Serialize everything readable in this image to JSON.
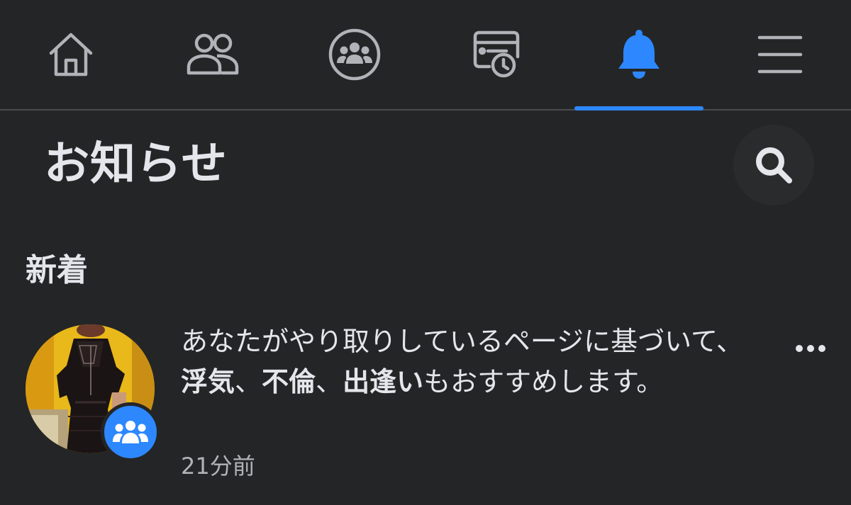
{
  "colors": {
    "background": "#242526",
    "accent": "#2d88ff",
    "text_primary": "#e4e6eb",
    "text_secondary": "#b0b3b8",
    "icon_inactive": "#b0b3b8"
  },
  "tabs": [
    {
      "icon": "home-icon",
      "active": false
    },
    {
      "icon": "friends-icon",
      "active": false
    },
    {
      "icon": "groups-icon",
      "active": false
    },
    {
      "icon": "feeds-clock-icon",
      "active": false
    },
    {
      "icon": "bell-icon",
      "active": true
    },
    {
      "icon": "hamburger-menu-icon",
      "active": false
    }
  ],
  "header": {
    "title": "お知らせ",
    "search_icon": "search-icon"
  },
  "section": {
    "title": "新着"
  },
  "notification": {
    "text_prefix": "あなたがやり取りしているページに基づいて、",
    "highlight_1": "浮気",
    "sep_1": "、",
    "highlight_2": "不倫",
    "sep_2": "、",
    "highlight_3": "出逢い",
    "text_suffix": "もおすすめします。",
    "time": "21分前",
    "badge_icon": "group-icon",
    "more_icon": "more-options-icon"
  }
}
